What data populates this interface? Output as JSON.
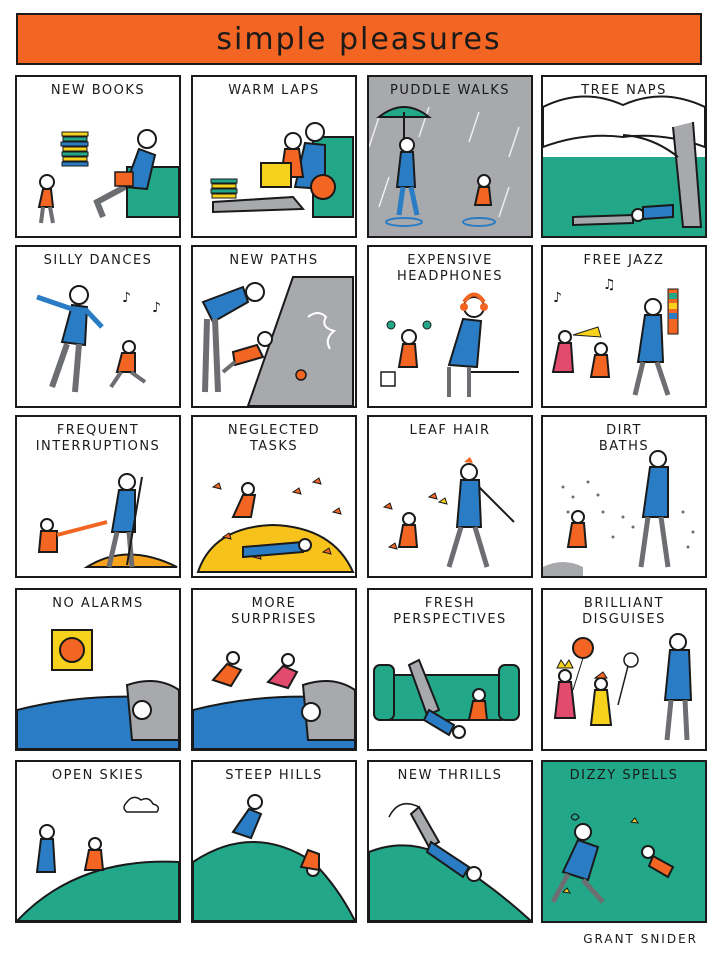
{
  "title": "simple pleasures",
  "credit": "GRANT SNIDER",
  "panels": [
    {
      "caption": "NEW BOOKS"
    },
    {
      "caption": "WARM LAPS"
    },
    {
      "caption": "PUDDLE WALKS"
    },
    {
      "caption": "TREE NAPS"
    },
    {
      "caption": "SILLY DANCES"
    },
    {
      "caption": "NEW PATHS"
    },
    {
      "caption": "EXPENSIVE\nHEADPHONES"
    },
    {
      "caption": "FREE JAZZ"
    },
    {
      "caption": "FREQUENT\nINTERRUPTIONS"
    },
    {
      "caption": "NEGLECTED\nTASKS"
    },
    {
      "caption": "LEAF HAIR"
    },
    {
      "caption": "DIRT\nBATHS"
    },
    {
      "caption": "NO ALARMS"
    },
    {
      "caption": "MORE\nSURPRISES"
    },
    {
      "caption": "FRESH\nPERSPECTIVES"
    },
    {
      "caption": "BRILLIANT\nDISGUISES"
    },
    {
      "caption": "OPEN SKIES"
    },
    {
      "caption": "STEEP HILLS"
    },
    {
      "caption": "NEW THRILLS"
    },
    {
      "caption": "DIZZY SPELLS"
    }
  ],
  "colors": {
    "banner": "#f26522",
    "teal": "#22a889",
    "blue": "#2a7dc4",
    "orange": "#f26522",
    "gray": "#a7a9ac",
    "yellow": "#f7d21c"
  }
}
